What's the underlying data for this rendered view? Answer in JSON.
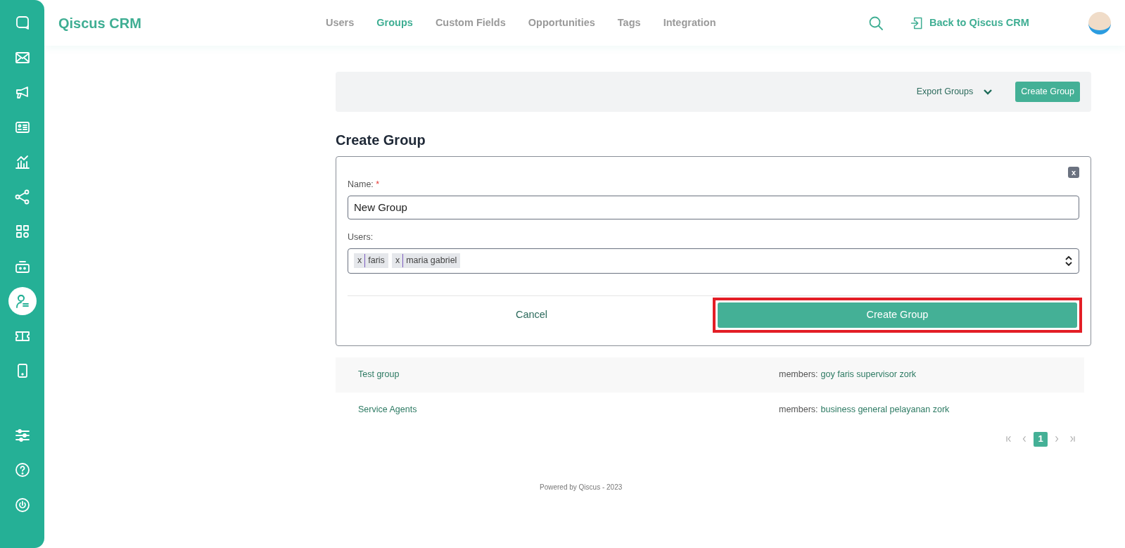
{
  "sidebar": {
    "items": [
      {
        "kind": "chat",
        "selected": false
      },
      {
        "kind": "mail",
        "selected": false
      },
      {
        "kind": "megaphone",
        "selected": false
      },
      {
        "kind": "card",
        "selected": false
      },
      {
        "kind": "chart",
        "selected": false
      },
      {
        "kind": "share",
        "selected": false
      },
      {
        "kind": "apps",
        "selected": false
      },
      {
        "kind": "robot",
        "selected": false
      },
      {
        "kind": "agent",
        "selected": true
      },
      {
        "kind": "ticket",
        "selected": false
      },
      {
        "kind": "tablet",
        "selected": false
      }
    ],
    "bottom_items": [
      {
        "kind": "sliders"
      },
      {
        "kind": "help"
      },
      {
        "kind": "power"
      }
    ]
  },
  "header": {
    "brand": "Qiscus CRM",
    "tabs": [
      {
        "label": "Users",
        "selected": false
      },
      {
        "label": "Groups",
        "selected": true
      },
      {
        "label": "Custom Fields",
        "selected": false
      },
      {
        "label": "Opportunities",
        "selected": false
      },
      {
        "label": "Tags",
        "selected": false
      },
      {
        "label": "Integration",
        "selected": false
      }
    ],
    "back_link": "Back to Qiscus CRM"
  },
  "toolbar": {
    "export": "Export Groups",
    "create": "Create Group"
  },
  "form": {
    "title": "Create Group",
    "close": "x",
    "name_label": "Name:",
    "required_mark": "*",
    "name_value": "New Group",
    "users_label": "Users:",
    "users": [
      {
        "remove": "x",
        "name": "faris"
      },
      {
        "remove": "x",
        "name": "maria gabriel"
      }
    ],
    "cancel": "Cancel",
    "submit": {
      "label": "Create Group",
      "highlighted": true
    }
  },
  "groups": [
    {
      "name": "Test group",
      "members_label": "members:",
      "members": "goy faris supervisor zork"
    },
    {
      "name": "Service Agents",
      "members_label": "members:",
      "members": "business general pelayanan zork"
    }
  ],
  "pagination": [
    {
      "kind": "first"
    },
    {
      "kind": "prev"
    },
    {
      "kind": "page",
      "label": "1",
      "selected": true
    },
    {
      "kind": "next"
    },
    {
      "kind": "last"
    }
  ],
  "footer": "Powered by Qiscus - 2023"
}
